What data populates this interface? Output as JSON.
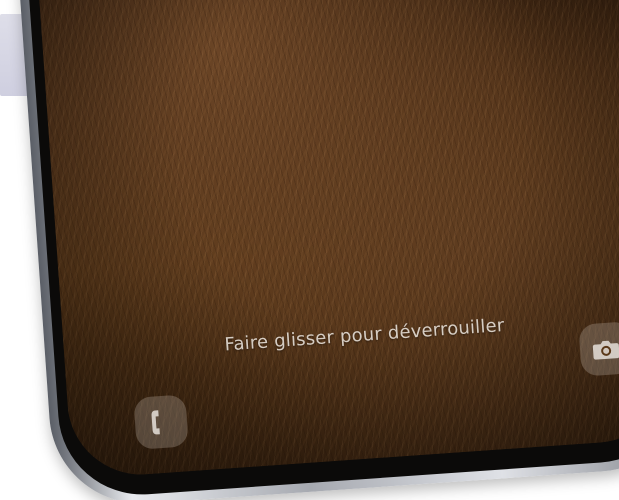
{
  "lock_screen": {
    "unlock_hint": "Faire glisser pour déverrouiller",
    "left_shortcut_icon": "phone-icon",
    "right_shortcut_icon": "camera-icon"
  },
  "colors": {
    "wallpaper": "#4a2d15",
    "frame": "#c9ccd2",
    "hint_text": "#ebe4dc"
  }
}
